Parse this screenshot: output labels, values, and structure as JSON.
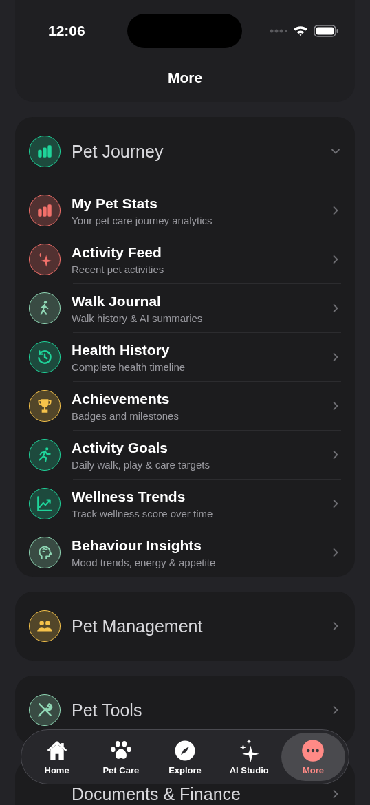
{
  "status_bar": {
    "time": "12:06"
  },
  "header": {
    "title": "More"
  },
  "sections": [
    {
      "title": "Pet Journey",
      "color": "#1fd49a",
      "expanded": true,
      "items": [
        {
          "title": "My Pet Stats",
          "subtitle": "Your pet care journey analytics",
          "color": "#f2706a"
        },
        {
          "title": "Activity Feed",
          "subtitle": "Recent pet activities",
          "color": "#f2706a"
        },
        {
          "title": "Walk Journal",
          "subtitle": "Walk history & AI summaries",
          "color": "#8fd6b4"
        },
        {
          "title": "Health History",
          "subtitle": "Complete health timeline",
          "color": "#1fd49a"
        },
        {
          "title": "Achievements",
          "subtitle": "Badges and milestones",
          "color": "#f5c24a"
        },
        {
          "title": "Activity Goals",
          "subtitle": "Daily walk, play & care targets",
          "color": "#1fd49a"
        },
        {
          "title": "Wellness Trends",
          "subtitle": "Track wellness score over time",
          "color": "#1fd49a"
        },
        {
          "title": "Behaviour Insights",
          "subtitle": "Mood trends, energy & appetite",
          "color": "#8fd6b4"
        }
      ]
    },
    {
      "title": "Pet Management",
      "color": "#f5c24a",
      "expanded": false
    },
    {
      "title": "Pet Tools",
      "color": "#8fd6b4",
      "expanded": false
    },
    {
      "title": "Documents & Finance",
      "expanded": false
    }
  ],
  "tabs": [
    {
      "label": "Home",
      "selected": false
    },
    {
      "label": "Pet Care",
      "selected": false
    },
    {
      "label": "Explore",
      "selected": false
    },
    {
      "label": "AI Studio",
      "selected": false
    },
    {
      "label": "More",
      "selected": true
    }
  ]
}
